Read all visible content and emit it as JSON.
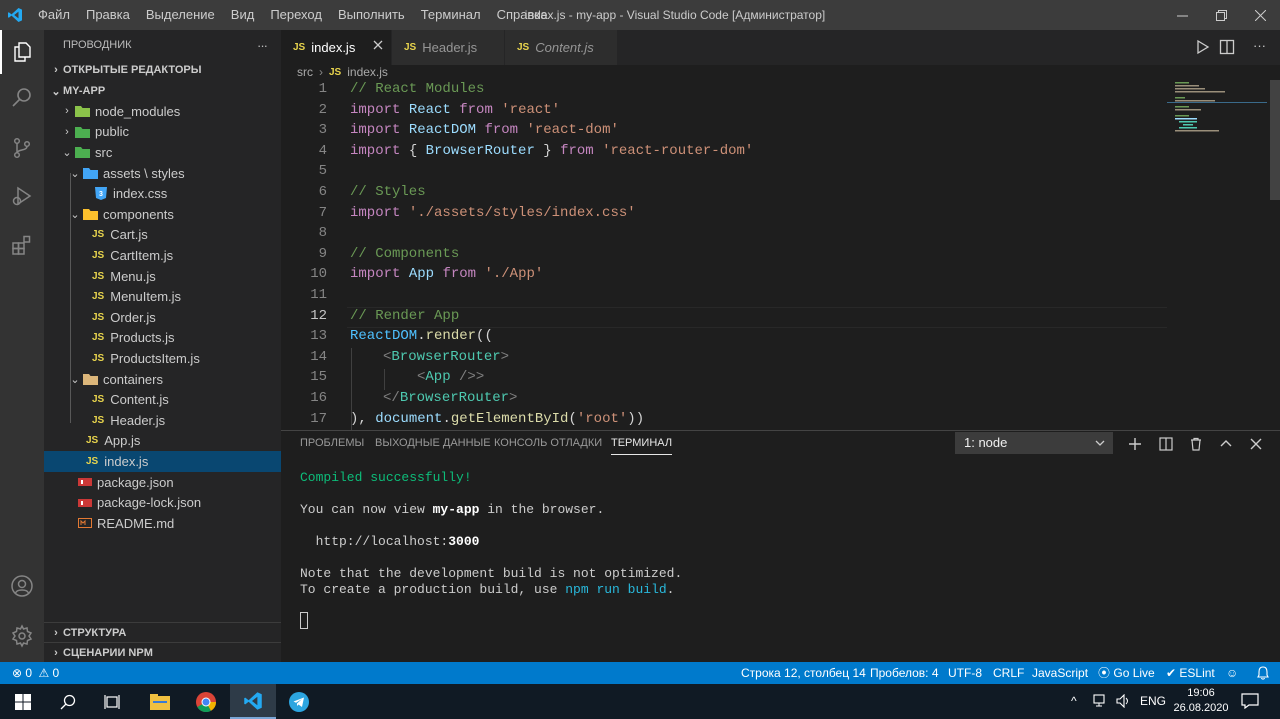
{
  "window": {
    "title": "index.js - my-app - Visual Studio Code [Администратор]",
    "menu": [
      "Файл",
      "Правка",
      "Выделение",
      "Вид",
      "Переход",
      "Выполнить",
      "Терминал",
      "Справка"
    ]
  },
  "sidebar": {
    "title": "ПРОВОДНИК",
    "more": "···",
    "open_editors": "ОТКРЫТЫЕ РЕДАКТОРЫ",
    "project": "MY-APP",
    "tree": [
      "node_modules",
      "public",
      "src",
      "assets \\ styles",
      "index.css",
      "components",
      "Cart.js",
      "CartItem.js",
      "Menu.js",
      "MenuItem.js",
      "Order.js",
      "Products.js",
      "ProductsItem.js",
      "containers",
      "Content.js",
      "Header.js",
      "App.js",
      "index.js",
      "package.json",
      "package-lock.json",
      "README.md"
    ],
    "outline": "СТРУКТУРА",
    "npm": "СЦЕНАРИИ NPM"
  },
  "tabs": [
    "index.js",
    "Header.js",
    "Content.js"
  ],
  "file_badge": "JS",
  "breadcrumb": {
    "folder": "src",
    "file": "index.js"
  },
  "editor": {
    "line_numbers": [
      "1",
      "2",
      "3",
      "4",
      "5",
      "6",
      "7",
      "8",
      "9",
      "10",
      "11",
      "12",
      "13",
      "14",
      "15",
      "16",
      "17"
    ],
    "comment_1": "// React Modules",
    "comment_6": "// Styles",
    "comment_9": "// Components",
    "comment_12": "// Render App",
    "kw_import": "import",
    "kw_from": "from",
    "id_react": "React",
    "id_reactdom": "ReactDOM",
    "id_browserrouter": "BrowserRouter",
    "id_app": "App",
    "str_react": "'react'",
    "str_reactdom": "'react-dom'",
    "str_router": "'react-router-dom'",
    "str_css": "'./assets/styles/index.css'",
    "str_app": "'./App'",
    "brace_open": "{",
    "brace_close": "}",
    "dot": ".",
    "fn_render": "render",
    "paren_open": "((",
    "tag_lt": "<",
    "tag_gt": ">",
    "tag_close_lt": "</",
    "tag_self": " />",
    "line17_a": "), ",
    "id_document": "document",
    "fn_getel": "getElementById",
    "str_root": "'root'",
    "line17_b": "))",
    "paren_single": "("
  },
  "panel": {
    "tabs": [
      "ПРОБЛЕМЫ",
      "ВЫХОДНЫЕ ДАННЫЕ",
      "КОНСОЛЬ ОТЛАДКИ",
      "ТЕРМИНАЛ"
    ],
    "terminal_select": "1: node",
    "terminal": {
      "compiled": "Compiled successfully!",
      "view_a": "You can now view ",
      "view_app": "my-app",
      "view_b": " in the browser.",
      "url_a": "  http://localhost:",
      "url_port": "3000",
      "note": "Note that the development build is not optimized.",
      "prod_a": "To create a production build, use ",
      "prod_cmd": "npm run build",
      "prod_b": "."
    }
  },
  "status": {
    "errors": "0",
    "warnings": "0",
    "position": "Строка 12, столбец 14",
    "spaces": "Пробелов: 4",
    "encoding": "UTF-8",
    "eol": "CRLF",
    "language": "JavaScript",
    "golive": "Go Live",
    "eslint": "ESLint"
  },
  "taskbar": {
    "lang": "ENG",
    "time": "19:06",
    "date": "26.08.2020"
  },
  "colors": {
    "accent": "#007acc",
    "selection": "#094771",
    "js_icon": "#e8d44d",
    "folder": "#dcb67a"
  }
}
